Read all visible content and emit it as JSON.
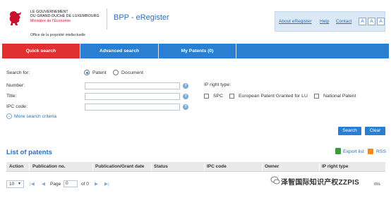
{
  "header": {
    "gov_line1": "LE GOUVERNEMENT",
    "gov_line2": "DU GRAND-DUCHÉ DE LUXEMBOURG",
    "ministry": "Ministère de l'Économie",
    "office": "Office de la propriété intellectuelle",
    "app_title": "BPP - eRegister",
    "links": {
      "about": "About eRegister",
      "help": "Help",
      "contact": "Contact"
    },
    "font_buttons": [
      "A",
      "A",
      "A"
    ]
  },
  "tabs": [
    {
      "label": "Quick search",
      "active": true
    },
    {
      "label": "Advanced search",
      "active": false
    },
    {
      "label": "My Patents (0)",
      "active": false
    }
  ],
  "form": {
    "search_for_label": "Search for:",
    "radio_patent": "Patent",
    "radio_document": "Document",
    "number_label": "Number:",
    "number_value": "",
    "title_label": "Title:",
    "title_value": "",
    "ipc_label": "IPC code:",
    "ipc_value": "",
    "help_glyph": "?",
    "ip_right_type_label": "IP right type:",
    "ip_types": [
      "SPC",
      "European Patent Granted for LU",
      "National Patent"
    ],
    "more_criteria": "More search criteria",
    "search_button": "Search",
    "clear_button": "Clear"
  },
  "list": {
    "title": "List of patents",
    "export_label": "Export list",
    "rss_label": "RSS",
    "columns": [
      "Action",
      "Publication no.",
      "Publication/Grant date",
      "Status",
      "IPC code",
      "Owner",
      "IP right type"
    ]
  },
  "pager": {
    "page_size": "10",
    "page_label": "Page",
    "page_value": "0",
    "of_label": "of 0",
    "right_text": "ms"
  },
  "watermark": {
    "text": "泽智国际知识产权ZZPIS"
  },
  "colors": {
    "tab_bar": "#2a7fd3",
    "tab_active": "#e03030",
    "link_blue": "#2c6fb7",
    "link_panel": "#dbe9f7"
  }
}
